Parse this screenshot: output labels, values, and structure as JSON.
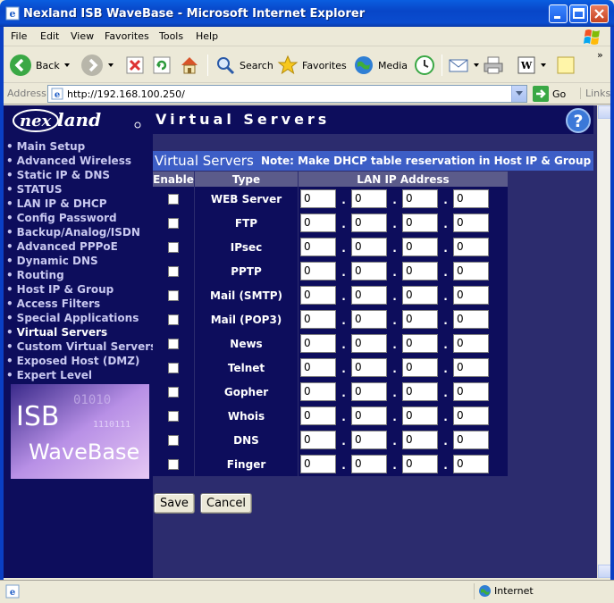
{
  "window": {
    "title": "Nexland ISB WaveBase - Microsoft Internet Explorer"
  },
  "menu": [
    "File",
    "Edit",
    "View",
    "Favorites",
    "Tools",
    "Help"
  ],
  "toolbar": {
    "back": "Back",
    "search": "Search",
    "favorites": "Favorites",
    "media": "Media"
  },
  "address": {
    "label": "Address",
    "url": "http://192.168.100.250/",
    "go": "Go",
    "links": "Links"
  },
  "page": {
    "title": "Virtual Servers",
    "section_title": "Virtual Servers",
    "note": "Note: Make DHCP table reservation in Host IP & Group"
  },
  "nav": [
    {
      "label": "Main Setup",
      "active": false
    },
    {
      "label": "Advanced Wireless",
      "active": false
    },
    {
      "label": "Static IP & DNS",
      "active": false
    },
    {
      "label": "STATUS",
      "active": false
    },
    {
      "label": "LAN IP & DHCP",
      "active": false
    },
    {
      "label": "Config Password",
      "active": false
    },
    {
      "label": "Backup/Analog/ISDN",
      "active": false
    },
    {
      "label": "Advanced PPPoE",
      "active": false
    },
    {
      "label": "Dynamic DNS",
      "active": false
    },
    {
      "label": "Routing",
      "active": false
    },
    {
      "label": "Host IP & Group",
      "active": false
    },
    {
      "label": "Access Filters",
      "active": false
    },
    {
      "label": "Special Applications",
      "active": false
    },
    {
      "label": "Virtual Servers",
      "active": true
    },
    {
      "label": "Custom Virtual Servers",
      "active": false
    },
    {
      "label": "Exposed Host (DMZ)",
      "active": false
    },
    {
      "label": "Expert Level",
      "active": false
    }
  ],
  "product_image": {
    "line1": "ISB",
    "line2": "WaveBase"
  },
  "table": {
    "headers": {
      "enable": "Enable",
      "type": "Type",
      "ip": "LAN IP Address"
    },
    "rows": [
      {
        "type": "WEB Server",
        "enabled": false,
        "ip": [
          "0",
          "0",
          "0",
          "0"
        ]
      },
      {
        "type": "FTP",
        "enabled": false,
        "ip": [
          "0",
          "0",
          "0",
          "0"
        ]
      },
      {
        "type": "IPsec",
        "enabled": false,
        "ip": [
          "0",
          "0",
          "0",
          "0"
        ]
      },
      {
        "type": "PPTP",
        "enabled": false,
        "ip": [
          "0",
          "0",
          "0",
          "0"
        ]
      },
      {
        "type": "Mail (SMTP)",
        "enabled": false,
        "ip": [
          "0",
          "0",
          "0",
          "0"
        ]
      },
      {
        "type": "Mail (POP3)",
        "enabled": false,
        "ip": [
          "0",
          "0",
          "0",
          "0"
        ]
      },
      {
        "type": "News",
        "enabled": false,
        "ip": [
          "0",
          "0",
          "0",
          "0"
        ]
      },
      {
        "type": "Telnet",
        "enabled": false,
        "ip": [
          "0",
          "0",
          "0",
          "0"
        ]
      },
      {
        "type": "Gopher",
        "enabled": false,
        "ip": [
          "0",
          "0",
          "0",
          "0"
        ]
      },
      {
        "type": "Whois",
        "enabled": false,
        "ip": [
          "0",
          "0",
          "0",
          "0"
        ]
      },
      {
        "type": "DNS",
        "enabled": false,
        "ip": [
          "0",
          "0",
          "0",
          "0"
        ]
      },
      {
        "type": "Finger",
        "enabled": false,
        "ip": [
          "0",
          "0",
          "0",
          "0"
        ]
      }
    ]
  },
  "buttons": {
    "save": "Save",
    "cancel": "Cancel"
  },
  "status": {
    "zone": "Internet"
  },
  "colors": {
    "sidebar_bg": "#0d0d5c",
    "page_bg": "#2c2c6e",
    "section_band": "#3d5ec6",
    "table_header": "#5b5b8a"
  }
}
